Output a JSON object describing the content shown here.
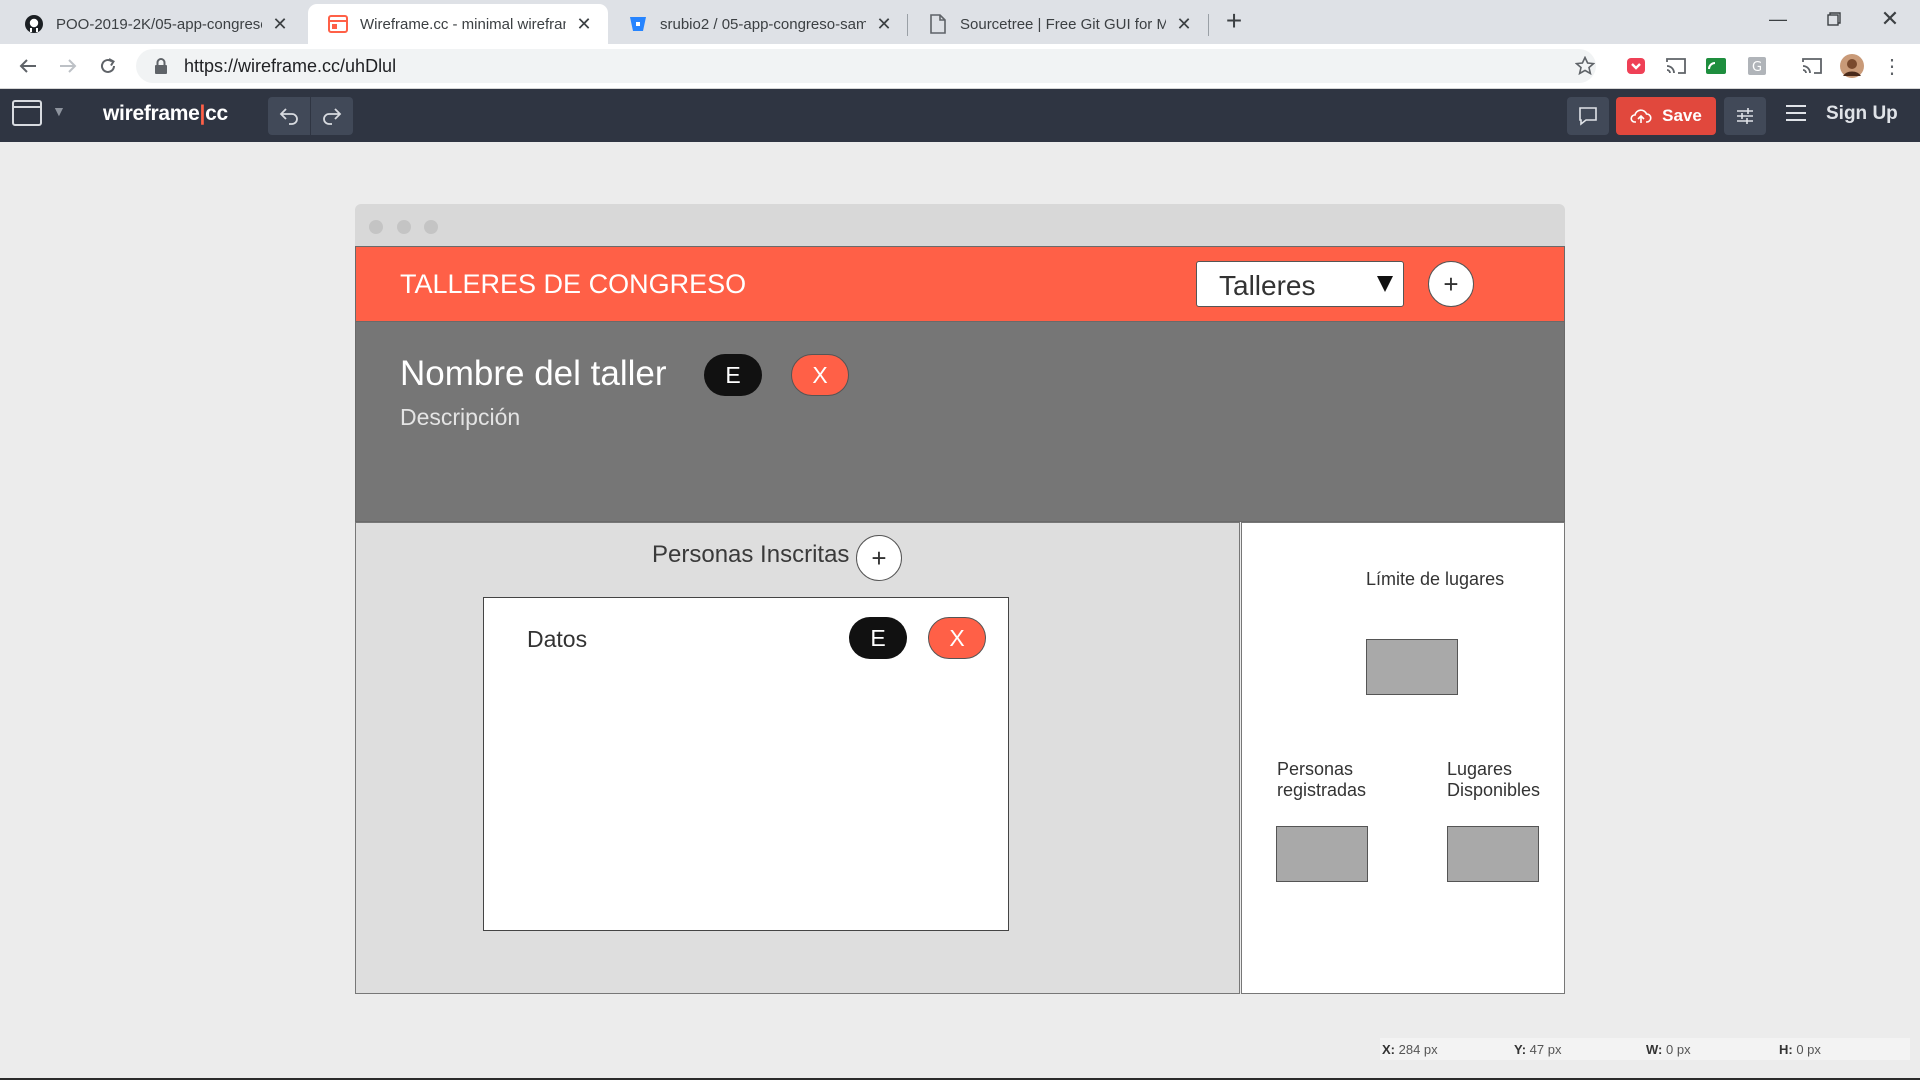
{
  "browser": {
    "tabs": [
      {
        "title": "POO-2019-2K/05-app-congreso",
        "icon": "github-icon"
      },
      {
        "title": "Wireframe.cc - minimal wirefram",
        "icon": "wireframe-icon"
      },
      {
        "title": "srubio2 / 05-app-congreso-sama",
        "icon": "bitbucket-icon"
      },
      {
        "title": "Sourcetree | Free Git GUI for Mac",
        "icon": "document-icon"
      }
    ],
    "url": "https://wireframe.cc/uhDlul"
  },
  "app": {
    "logo_main": "wireframe",
    "logo_sep": "|",
    "logo_cc": "cc",
    "save_label": "Save",
    "signup_label": "Sign Up"
  },
  "wireframe": {
    "header_title": "TALLERES DE CONGRESO",
    "select_value": "Talleres",
    "add_symbol": "+",
    "detail_name": "Nombre del taller",
    "detail_desc": "Descripción",
    "edit_label": "E",
    "delete_label": "X",
    "left_title": "Personas Inscritas",
    "card_title": "Datos",
    "limit_label": "Límite de lugares",
    "registered_label": "Personas registradas",
    "available_label": "Lugares Disponibles"
  },
  "status": {
    "x_label": "X:",
    "x_value": "284 px",
    "y_label": "Y:",
    "y_value": "47 px",
    "w_label": "W:",
    "w_value": "0 px",
    "h_label": "H:",
    "h_value": "0 px"
  },
  "colors": {
    "accent": "#ff6047",
    "appbar": "#2f3542",
    "save": "#e1483d",
    "detail_bg": "#767676"
  }
}
